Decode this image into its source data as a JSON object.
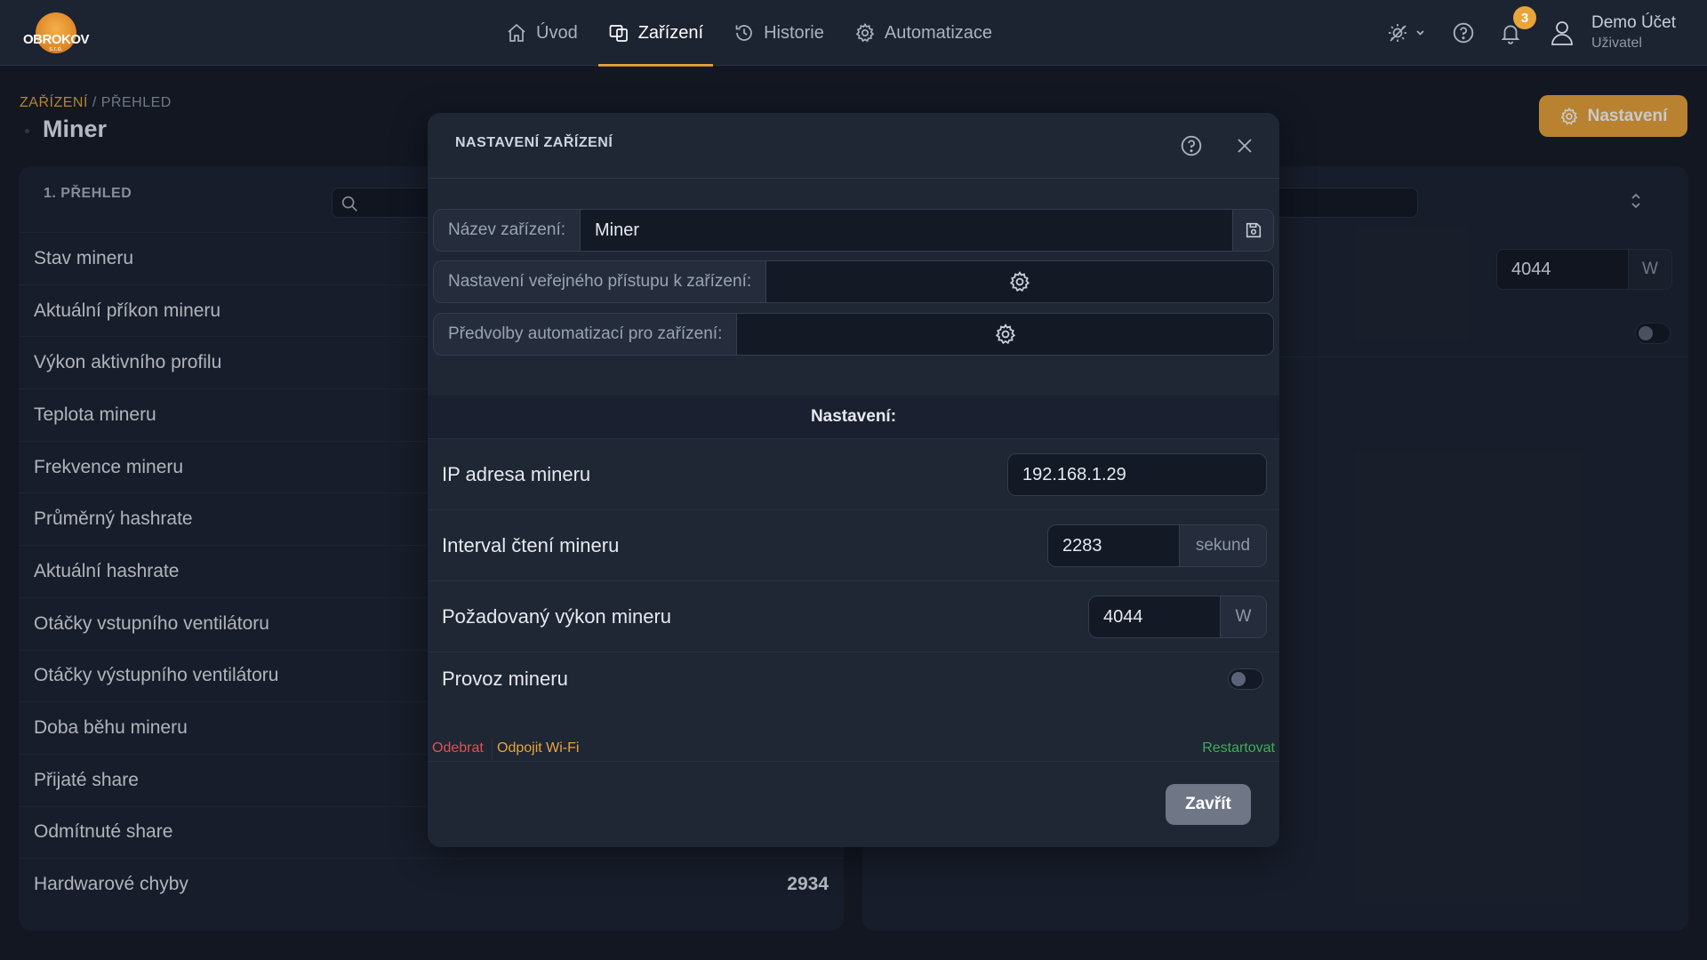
{
  "brand": {
    "name": "OBROKOV",
    "suffix": "s.r.o."
  },
  "nav": {
    "items": [
      {
        "label": "Úvod",
        "active": false
      },
      {
        "label": "Zařízení",
        "active": true
      },
      {
        "label": "Historie",
        "active": false
      },
      {
        "label": "Automatizace",
        "active": false
      }
    ]
  },
  "topbar": {
    "notifications_count": "3",
    "user_name": "Demo Účet",
    "user_role": "Uživatel"
  },
  "page": {
    "breadcrumb_link": "ZAŘÍZENÍ",
    "breadcrumb_sep": "/",
    "breadcrumb_current": "PŘEHLED",
    "title": "Miner",
    "settings_label": "Nastavení"
  },
  "left_panel": {
    "heading": "1. PŘEHLED",
    "rows": [
      {
        "label": "Stav mineru",
        "value": ""
      },
      {
        "label": "Aktuální příkon mineru",
        "value": ""
      },
      {
        "label": "Výkon aktivního profilu",
        "value": ""
      },
      {
        "label": "Teplota mineru",
        "value": ""
      },
      {
        "label": "Frekvence mineru",
        "value": ""
      },
      {
        "label": "Průměrný hashrate",
        "value": ""
      },
      {
        "label": "Aktuální hashrate",
        "value": ""
      },
      {
        "label": "Otáčky vstupního ventilátoru",
        "value": ""
      },
      {
        "label": "Otáčky výstupního ventilátoru",
        "value": ""
      },
      {
        "label": "Doba běhu mineru",
        "value": ""
      },
      {
        "label": "Přijaté share",
        "value": ""
      },
      {
        "label": "Odmítnuté share",
        "value": ""
      },
      {
        "label": "Hardwarové chyby",
        "value": "2934"
      }
    ]
  },
  "right_panel": {
    "power_value": "4044",
    "power_unit": "W"
  },
  "modal": {
    "title": "NASTAVENÍ ZAŘÍZENÍ",
    "name_label": "Název zařízení:",
    "name_value": "Miner",
    "public_access_label": "Nastavení veřejného přístupu k zařízení:",
    "automation_presets_label": "Předvolby automatizací pro zařízení:",
    "section_title": "Nastavení:",
    "settings": {
      "ip_label": "IP adresa mineru",
      "ip_value": "192.168.1.29",
      "interval_label": "Interval čtení mineru",
      "interval_value": "2283",
      "interval_unit": "sekund",
      "power_label": "Požadovaný výkon mineru",
      "power_value": "4044",
      "power_unit": "W",
      "operation_label": "Provoz mineru"
    },
    "actions": {
      "remove": "Odebrat",
      "disconnect_wifi": "Odpojit Wi-Fi",
      "restart": "Restartovat"
    },
    "close_label": "Zavřít"
  },
  "colors": {
    "accent": "#e9a43a",
    "danger": "#e05353",
    "success": "#3fae5a",
    "background": "#151b27",
    "panel": "#1c2331"
  }
}
